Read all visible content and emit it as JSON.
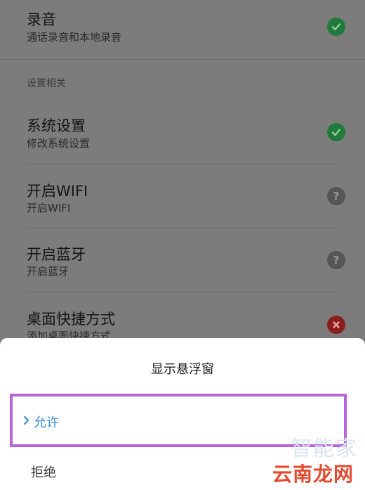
{
  "permissions": [
    {
      "title": "录音",
      "subtitle": "通话录音和本地录音",
      "status": "granted",
      "icon": "check-icon"
    },
    {
      "title": "系统设置",
      "subtitle": "修改系统设置",
      "status": "granted",
      "icon": "check-icon"
    },
    {
      "title": "开启WIFI",
      "subtitle": "开启WIFI",
      "status": "ask",
      "icon": "question-icon"
    },
    {
      "title": "开启蓝牙",
      "subtitle": "开启蓝牙",
      "status": "ask",
      "icon": "question-icon"
    },
    {
      "title": "桌面快捷方式",
      "subtitle": "添加桌面快捷方式",
      "status": "denied",
      "icon": "cross-icon"
    }
  ],
  "section_header": "设置相关",
  "dialog": {
    "title": "显示悬浮窗",
    "allow_label": "允许",
    "deny_label": "拒绝"
  },
  "watermark": {
    "top": "智能家",
    "bottom": "云南龙网"
  },
  "colors": {
    "granted": "#217a3c",
    "ask": "#565656",
    "denied": "#8a1e1a",
    "highlight_border": "#b565d9",
    "selected_text": "#3a8fd6"
  }
}
